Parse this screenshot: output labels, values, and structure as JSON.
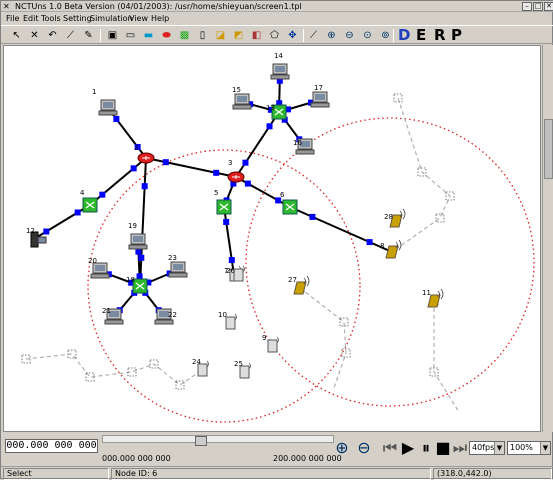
{
  "window": {
    "title": "NCTUns 1.0 Beta Version (04/01/2003): /usr/home/shieyuan/screen1.tpl",
    "app_icon": "x-nctuns-icon"
  },
  "menu": [
    "File",
    "Edit",
    "Tools",
    "Setting",
    "Simulation",
    "View",
    "Help"
  ],
  "toolbar": {
    "mode_letters": [
      "D",
      "E",
      "R",
      "P"
    ],
    "tools": [
      "pointer-icon",
      "delete-icon",
      "undo-icon",
      "link-icon",
      "pen-icon",
      "host-icon",
      "switch-icon",
      "hub-icon",
      "router-icon",
      "wlan-ap-icon",
      "mobile-node-icon",
      "phone-icon",
      "bus-icon",
      "car-icon",
      "obstacle-icon",
      "move-icon",
      "draw-icon",
      "zoom-in-icon",
      "zoom-out-icon",
      "zoom-fit-icon",
      "zoom-reset-icon"
    ]
  },
  "nodes": [
    {
      "id": "1",
      "type": "host"
    },
    {
      "id": "2",
      "type": "router"
    },
    {
      "id": "3",
      "type": "router"
    },
    {
      "id": "4",
      "type": "switch"
    },
    {
      "id": "5",
      "type": "switch"
    },
    {
      "id": "6",
      "type": "switch"
    },
    {
      "id": "7",
      "type": "mobile"
    },
    {
      "id": "8",
      "type": "ap"
    },
    {
      "id": "9",
      "type": "mobile"
    },
    {
      "id": "10",
      "type": "mobile"
    },
    {
      "id": "11",
      "type": "ap"
    },
    {
      "id": "12",
      "type": "phone"
    },
    {
      "id": "13",
      "type": "switch"
    },
    {
      "id": "14",
      "type": "host"
    },
    {
      "id": "15",
      "type": "host"
    },
    {
      "id": "16",
      "type": "host"
    },
    {
      "id": "17",
      "type": "host"
    },
    {
      "id": "18",
      "type": "switch"
    },
    {
      "id": "19",
      "type": "host"
    },
    {
      "id": "20",
      "type": "host"
    },
    {
      "id": "21",
      "type": "host"
    },
    {
      "id": "22",
      "type": "host"
    },
    {
      "id": "23",
      "type": "host"
    },
    {
      "id": "24",
      "type": "mobile"
    },
    {
      "id": "25",
      "type": "mobile"
    },
    {
      "id": "26",
      "type": "mobile"
    },
    {
      "id": "27",
      "type": "ap"
    },
    {
      "id": "28",
      "type": "ap"
    }
  ],
  "playback": {
    "time_start": "000.000 000 000",
    "time_left_label": "000.000 000 000",
    "time_right_label": "200.000 000 000",
    "fps": "40fps",
    "zoom": "100%",
    "slider_position": 0.42
  },
  "status": {
    "mode": "Select",
    "node": "Node ID: 6",
    "coords": "(318.0,442.0)"
  },
  "colors": {
    "range_circle": "#e02020",
    "link": "#000000",
    "port": "#0000ff",
    "switch": "#2db82d",
    "router": "#e02020",
    "ap": "#c8a000",
    "path": "#b0b0b0"
  }
}
